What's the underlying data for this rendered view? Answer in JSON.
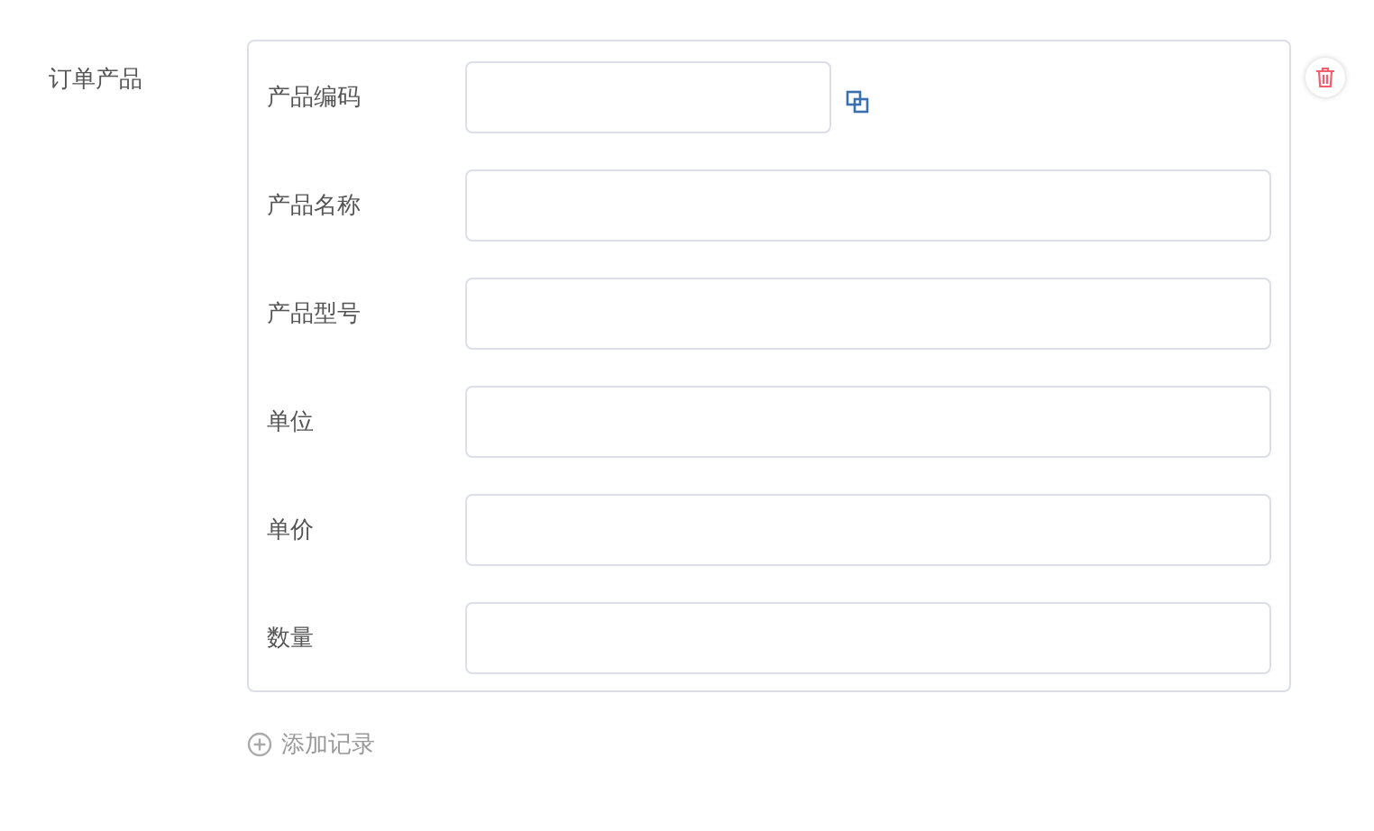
{
  "section_label": "订单产品",
  "fields": [
    {
      "label": "产品编码",
      "kind": "lookup"
    },
    {
      "label": "产品名称",
      "kind": "text"
    },
    {
      "label": "产品型号",
      "kind": "text"
    },
    {
      "label": "单位",
      "kind": "text"
    },
    {
      "label": "单价",
      "kind": "text"
    },
    {
      "label": "数量",
      "kind": "text"
    }
  ],
  "add_link": "添加记录"
}
